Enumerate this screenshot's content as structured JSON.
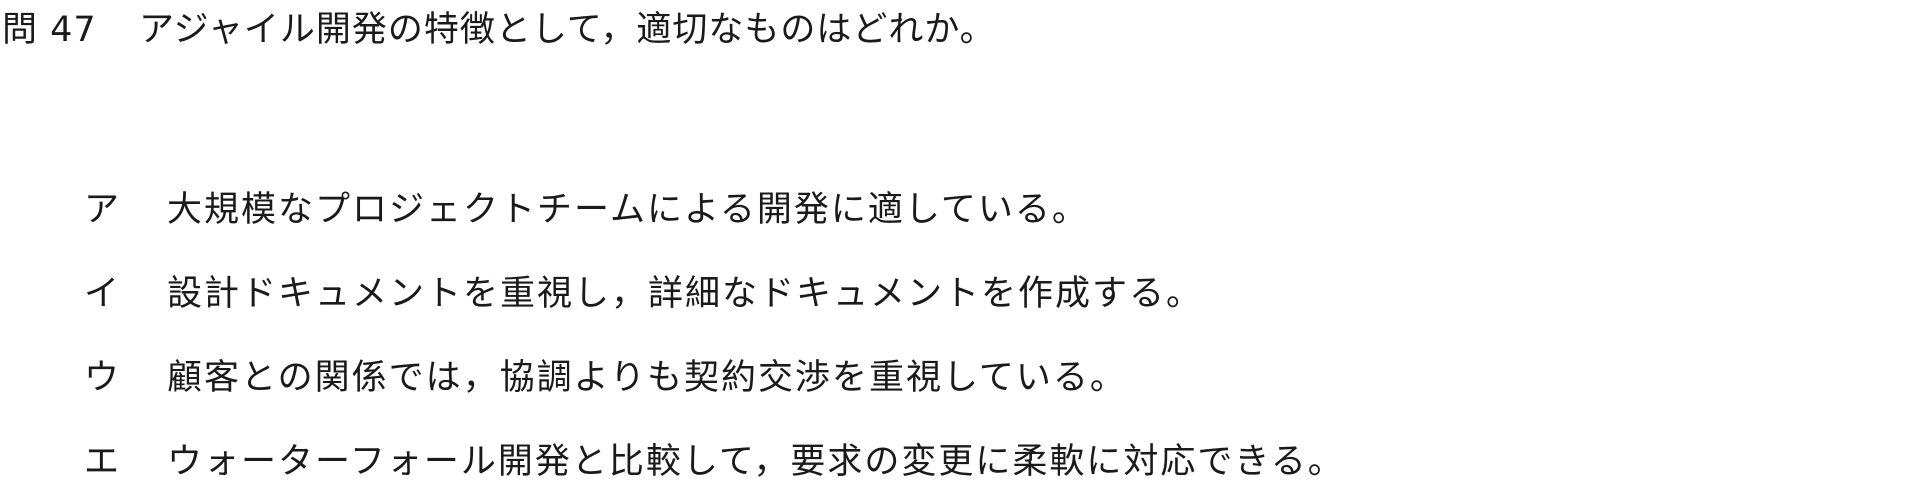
{
  "question": {
    "number": "問 47",
    "text": "アジャイル開発の特徴として，適切なものはどれか。"
  },
  "options": [
    {
      "letter": "ア",
      "text": "大規模なプロジェクトチームによる開発に適している。"
    },
    {
      "letter": "イ",
      "text": "設計ドキュメントを重視し，詳細なドキュメントを作成する。"
    },
    {
      "letter": "ウ",
      "text": "顧客との関係では，協調よりも契約交渉を重視している。"
    },
    {
      "letter": "エ",
      "text": "ウォーターフォール開発と比較して，要求の変更に柔軟に対応できる。"
    }
  ]
}
